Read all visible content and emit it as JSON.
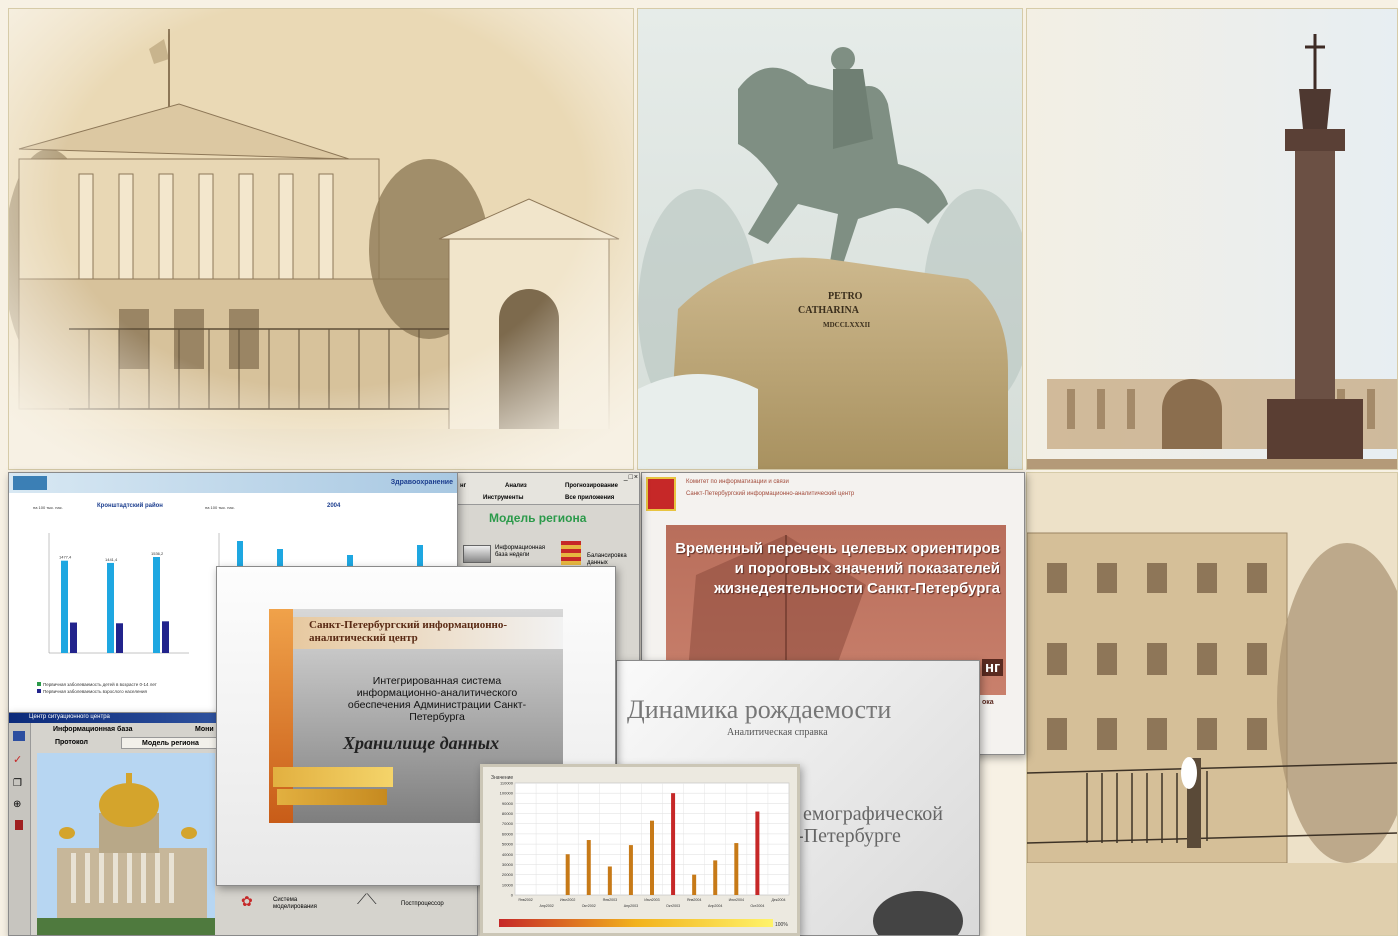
{
  "health_window": {
    "header": "Здравоохранение",
    "chart_left_title": "Кронштадтский район",
    "chart_left_unit": "на 100 тыс. нас.",
    "chart_right_title": "2004",
    "chart_right_unit": "на 100 тыс. нас.",
    "legend_1": "Первичная заболеваемость детей в возрасте 0-14 лет",
    "legend_2": "Первичная заболеваемость взрослого населения"
  },
  "region_window": {
    "menu": [
      "нг",
      "Анализ",
      "Прогнозирование",
      "Инструменты",
      "Все приложения"
    ],
    "title": "Модель региона",
    "item_1": "Информационная база недели",
    "item_2": "Балансировка данных"
  },
  "targets_window": {
    "header_1": "Комитет по информатизации и связи",
    "header_2": "Санкт-Петербургский информационно-аналитический центр",
    "title": "Временный перечень целевых ориентиров и пороговых значений показателей жизнедеятельности Санкт-Петербурга",
    "fragment_1": "нг",
    "fragment_2": "ока"
  },
  "warehouse_window": {
    "org": "Санкт-Петербургский информационно-аналитический центр",
    "system": "Интегрированная система информационно-аналитического обеспечения Администрации Санкт-Петербурга",
    "title": "Хранилище данных"
  },
  "sit_window": {
    "title": "Центр ситуационного центра",
    "tab_1": "Информационная база",
    "tab_2": "Мони",
    "tab_3": "Протокол",
    "tab_4": "Модель региона",
    "item_1": "Система моделирования",
    "item_2": "Постпроцессор"
  },
  "birth_window": {
    "title": "Динамика рождаемости",
    "subtitle": "Аналитическая справка",
    "line_1": "емографической",
    "line_2": "-Петербурге"
  },
  "chart_window": {
    "ylabel": "Значение",
    "scale_end": "100%"
  },
  "chart_data": {
    "type": "bar",
    "categories": [
      "Янв2002",
      "Апр2002",
      "Июл2002",
      "Окт2002",
      "Янв2003",
      "Апр2003",
      "Июл2003",
      "Окт2003",
      "Янв2004",
      "Апр2004",
      "Июл2004",
      "Окт2004",
      "Дек2004"
    ],
    "values": [
      0,
      0,
      40000,
      54000,
      28000,
      49000,
      73000,
      100000,
      20000,
      34000,
      51000,
      82000,
      0
    ],
    "ylim": [
      0,
      110000
    ],
    "yticks": [
      "110000",
      "100000",
      "90000",
      "80000",
      "70000",
      "60000",
      "50000",
      "40000",
      "30000",
      "20000",
      "10000",
      "0"
    ],
    "bar_colors": [
      "#c77a18",
      "#c77a18",
      "#c77a18",
      "#c77a18",
      "#c77a18",
      "#c77a18",
      "#c77a18",
      "#c62828",
      "#c77a18",
      "#c77a18",
      "#c77a18",
      "#c62828",
      "#c77a18"
    ],
    "grid": true
  },
  "mini_chart_left": {
    "type": "bar",
    "labels": [
      "1477,4",
      "1441,4",
      "1536,2"
    ],
    "values": [
      1477,
      1441,
      1536
    ]
  },
  "monument_inscription": [
    "PETRO",
    "CATHARINA",
    "MDCCLXXXII"
  ],
  "colors": {
    "sepia": "#c9b38a",
    "accent": "#c62828",
    "bar_blue": "#1ea7e1",
    "bar_navy": "#22238c"
  }
}
